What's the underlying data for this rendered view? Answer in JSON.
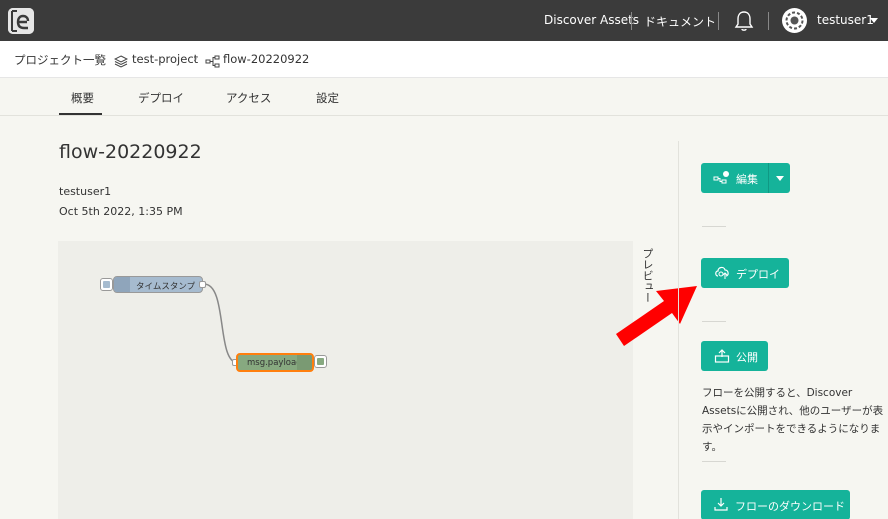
{
  "topbar": {
    "discover_label": "Discover Assets",
    "docs_label": "ドキュメント",
    "user_name": "testuser1"
  },
  "breadcrumb": {
    "projects_label": "プロジェクト一覧",
    "project_label": "test-project",
    "flow_label": "flow-20220922"
  },
  "tabs": [
    {
      "label": "概要"
    },
    {
      "label": "デプロイ"
    },
    {
      "label": "アクセス"
    },
    {
      "label": "設定"
    }
  ],
  "main": {
    "title": "flow-20220922",
    "owner": "testuser1",
    "date": "Oct 5th 2022, 1:35 PM",
    "preview_label": "プレビュー",
    "nodes": [
      {
        "label": "タイムスタンプ"
      },
      {
        "label": "msg.payload"
      }
    ]
  },
  "sidebar": {
    "edit_label": "編集",
    "deploy_label": "デプロイ",
    "publish_label": "公開",
    "publish_desc": "フローを公開すると、Discover Assetsに公開され、他のユーザーが表示やインポートをできるようになります。",
    "download_label": "フローのダウンロード"
  },
  "colors": {
    "topbar": "#3b3b3b",
    "accent": "#15b39a",
    "inject_node": "#a6bbcf",
    "debug_node": "#87a980",
    "selected_outline": "#ff7f0e",
    "arrow": "#ff0000"
  }
}
